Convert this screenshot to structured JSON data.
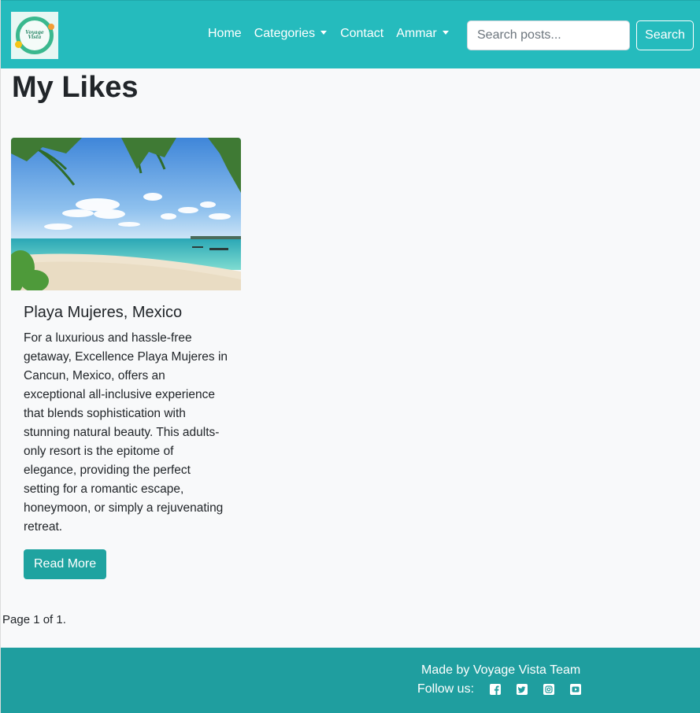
{
  "navbar": {
    "logo_text": "Voyage Vista",
    "links": {
      "home": "Home",
      "categories": "Categories",
      "contact": "Contact",
      "user": "Ammar"
    },
    "search_placeholder": "Search posts...",
    "search_button": "Search"
  },
  "main": {
    "title": "My Likes",
    "cards": [
      {
        "title": "Playa Mujeres, Mexico",
        "text": "For a luxurious and hassle-free getaway, Excellence Playa Mujeres in Cancun, Mexico, offers an exceptional all-inclusive experience that blends sophistication with stunning natural beauty. This adults-only resort is the epitome of elegance, providing the perfect setting for a romantic escape, honeymoon, or simply a rejuvenating retreat.",
        "button": "Read More"
      }
    ],
    "pagination": "Page 1 of 1."
  },
  "footer": {
    "made_by": "Made by Voyage Vista Team",
    "follow": "Follow us:",
    "social_icons": [
      "facebook-icon",
      "twitter-icon",
      "instagram-icon",
      "youtube-icon"
    ]
  },
  "colors": {
    "navbar": "#25bbbd",
    "footer": "#1f9e9f",
    "button": "#1fa3a0",
    "background": "#f8f9fa"
  }
}
